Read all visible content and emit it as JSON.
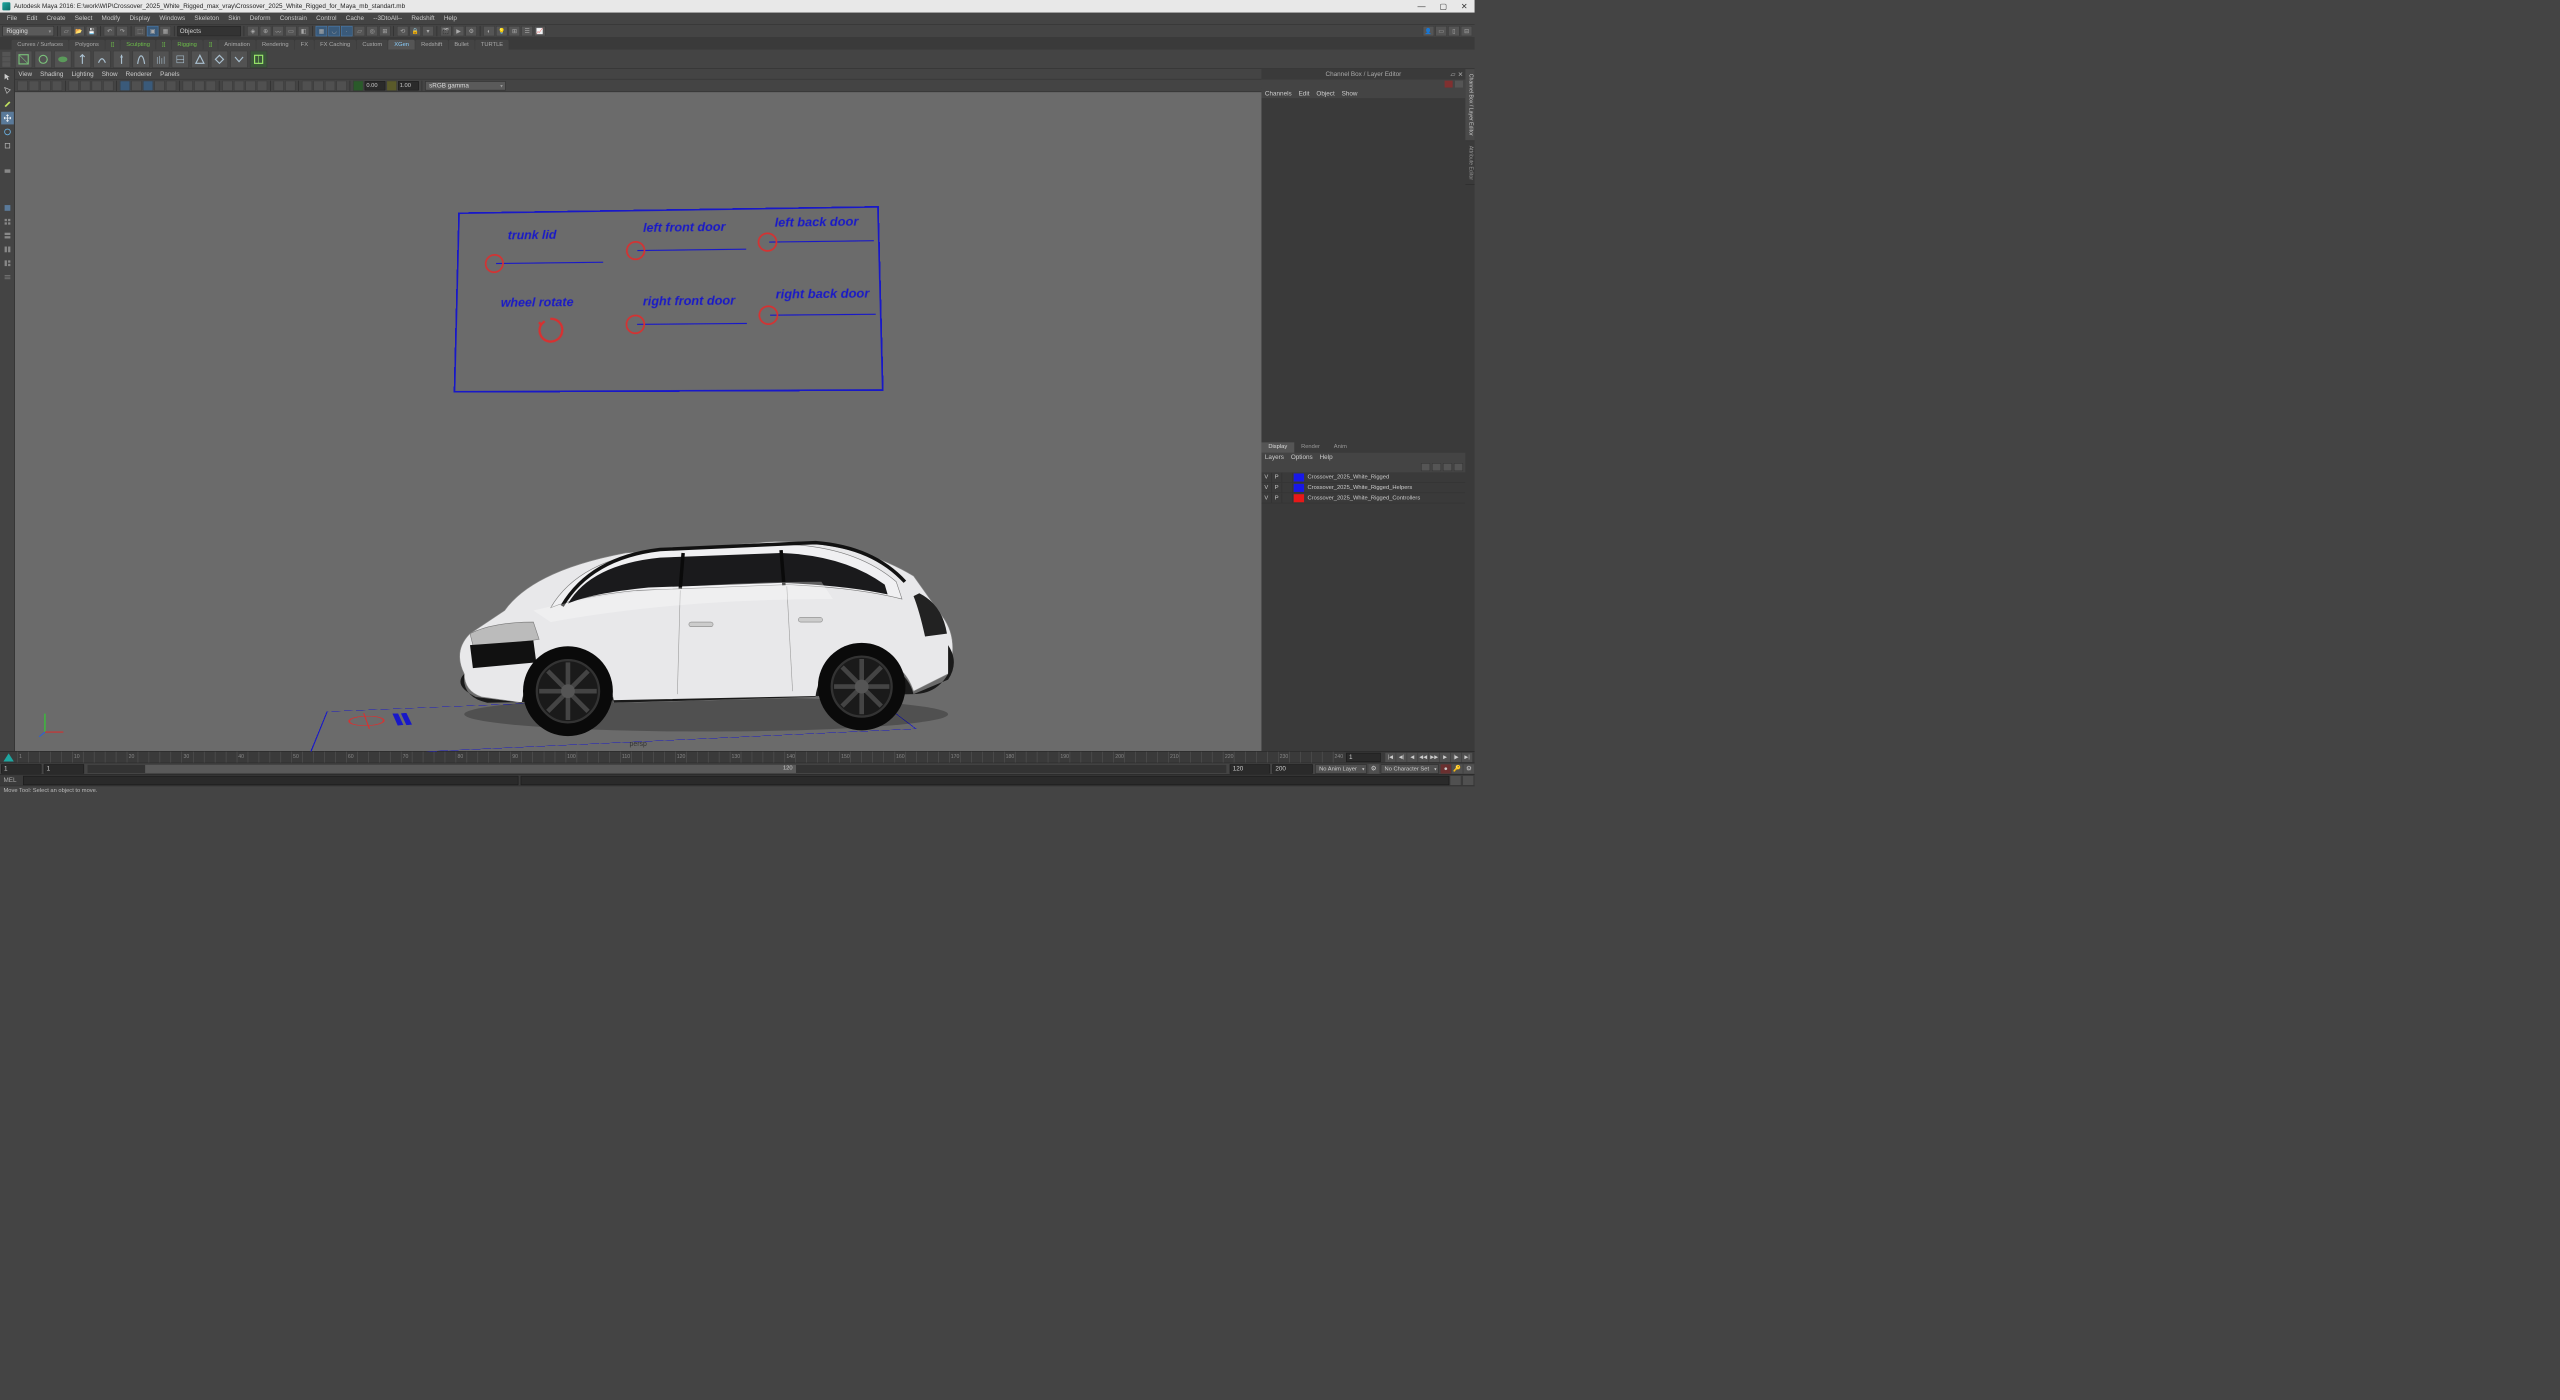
{
  "title": "Autodesk Maya 2016: E:\\work\\WIP\\Crossover_2025_White_Rigged_max_vray\\Crossover_2025_White_Rigged_for_Maya_mb_standart.mb",
  "menus": [
    "File",
    "Edit",
    "Create",
    "Select",
    "Modify",
    "Display",
    "Windows",
    "Skeleton",
    "Skin",
    "Deform",
    "Constrain",
    "Control",
    "Cache",
    "--3DtoAll--",
    "Redshift",
    "Help"
  ],
  "workspace": "Rigging",
  "masks_label": "Objects",
  "shelf_tabs": [
    "Curves / Surfaces",
    "Polygons",
    "Sculpting",
    "Rigging",
    "Animation",
    "Rendering",
    "FX",
    "FX Caching",
    "Custom",
    "XGen",
    "Redshift",
    "Bullet",
    "TURTLE"
  ],
  "shelf_active": "XGen",
  "shelf_bracket": [
    "Sculpting",
    "Rigging"
  ],
  "panel_menus": [
    "View",
    "Shading",
    "Lighting",
    "Show",
    "Renderer",
    "Panels"
  ],
  "gamma_field1": "0.00",
  "gamma_field2": "1.00",
  "colorspace": "sRGB gamma",
  "camera": "persp",
  "rig_controls": {
    "trunk": "trunk lid",
    "wheel": "wheel  rotate",
    "lf": "left front door",
    "lb": "left back door",
    "rf": "right front door",
    "rb": "right back door"
  },
  "channel_box_title": "Channel Box / Layer Editor",
  "channel_menus": [
    "Channels",
    "Edit",
    "Object",
    "Show"
  ],
  "layer_tabs": [
    "Display",
    "Render",
    "Anim"
  ],
  "layer_menus": [
    "Layers",
    "Options",
    "Help"
  ],
  "layers": [
    {
      "v": "V",
      "p": "P",
      "color": "#1818e8",
      "name": "Crossover_2025_White_Rigged"
    },
    {
      "v": "V",
      "p": "P",
      "color": "#1818e8",
      "name": "Crossover_2025_White_Rigged_Helpers"
    },
    {
      "v": "V",
      "p": "P",
      "color": "#e81818",
      "name": "Crossover_2025_White_Rigged_Controllers"
    }
  ],
  "side_vert_tabs": [
    "Channel Box / Layer Editor",
    "Attribute Editor"
  ],
  "time_start": "1",
  "time_cur": "1",
  "range_start": "1",
  "range_end_vis": "120",
  "range_min": "120",
  "range_max": "200",
  "anim_layer": "No Anim Layer",
  "char_set": "No Character Set",
  "cmd_label": "MEL",
  "helpline": "Move Tool: Select an object to move."
}
